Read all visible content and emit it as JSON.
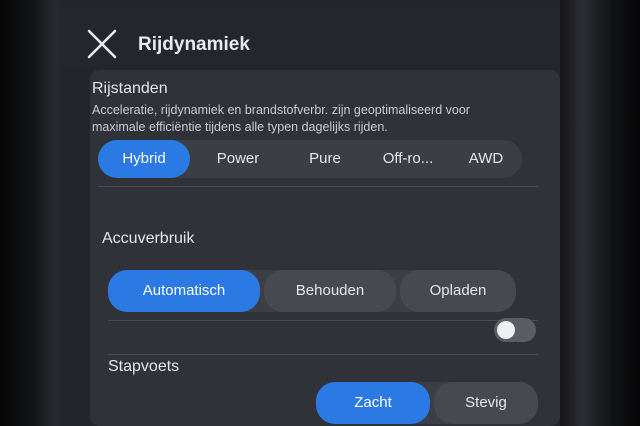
{
  "header": {
    "title": "Rijdynamiek",
    "close_icon": "close-icon"
  },
  "rijstanden": {
    "title": "Rijstanden",
    "description_line1": "Acceleratie, rijdynamiek en brandstofverbr. zijn geoptimaliseerd voor",
    "description_line2": "maximale efficiëntie tijdens alle typen dagelijks rijden.",
    "options": [
      "Hybrid",
      "Power",
      "Pure",
      "Off-ro...",
      "AWD"
    ],
    "selected": "Hybrid"
  },
  "accuverbruik": {
    "title": "Accuverbruik",
    "options": [
      "Automatisch",
      "Behouden",
      "Opladen"
    ],
    "selected": "Automatisch",
    "toggle_on": false
  },
  "stapvoets": {
    "title": "Stapvoets",
    "options": [
      "Zacht",
      "Stevig"
    ],
    "selected": "Zacht"
  },
  "colors": {
    "accent": "#2b7ae3",
    "panel": "#2f3238",
    "background": "#23252b"
  }
}
